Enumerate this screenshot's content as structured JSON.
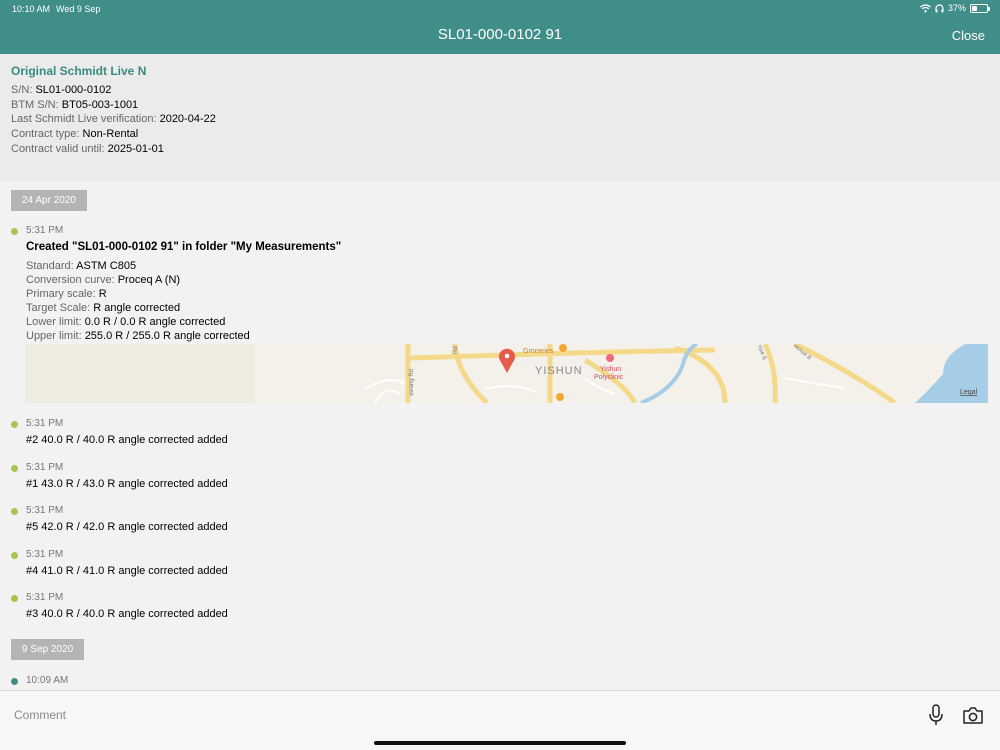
{
  "status_bar": {
    "time": "10:10 AM",
    "date": "Wed 9 Sep",
    "battery": "37%",
    "battery_level": 0.37
  },
  "nav": {
    "title": "SL01-000-0102 91",
    "close_label": "Close"
  },
  "device": {
    "name": "Original Schmidt Live N",
    "fields": [
      {
        "label": "S/N:",
        "value": "SL01-000-0102"
      },
      {
        "label": "BTM S/N:",
        "value": "BT05-003-1001"
      },
      {
        "label": "Last Schmidt Live verification:",
        "value": "2020-04-22"
      },
      {
        "label": "Contract type:",
        "value": "Non-Rental"
      },
      {
        "label": "Contract valid until:",
        "value": "2025-01-01"
      }
    ]
  },
  "timeline": {
    "date1": "24 Apr 2020",
    "created": {
      "time": "5:31 PM",
      "title": "Created \"SL01-000-0102 91\" in folder \"My Measurements\"",
      "details": [
        {
          "label": "Standard:",
          "value": "ASTM C805"
        },
        {
          "label": "Conversion curve:",
          "value": "Proceq A (N)"
        },
        {
          "label": "Primary scale:",
          "value": "R"
        },
        {
          "label": "Target Scale:",
          "value": "R angle corrected"
        },
        {
          "label": "Lower limit:",
          "value": "0.0 R / 0.0 R angle corrected"
        },
        {
          "label": "Upper limit:",
          "value": "255.0 R / 255.0 R angle corrected"
        }
      ]
    },
    "map": {
      "area_label": "YISHUN",
      "poi1": "Groceries",
      "poi2": "Yishun\nPolyclinic",
      "poi2_line1": "Yishun",
      "poi2_line2": "Polyclinic",
      "road1": "awang Rd",
      "road2": "Rd",
      "road3": "nue 6",
      "road4": "venue 8",
      "legal": "Legal"
    },
    "measurements": [
      {
        "time": "5:31 PM",
        "text": "#2 40.0 R / 40.0 R angle corrected added"
      },
      {
        "time": "5:31 PM",
        "text": "#1 43.0 R / 43.0 R angle corrected added"
      },
      {
        "time": "5:31 PM",
        "text": "#5 42.0 R / 42.0 R angle corrected added"
      },
      {
        "time": "5:31 PM",
        "text": "#4 41.0 R / 41.0 R angle corrected added"
      },
      {
        "time": "5:31 PM",
        "text": "#3 40.0 R / 40.0 R angle corrected added"
      }
    ],
    "date2": "9 Sep 2020",
    "last_entry_time": "10:09 AM"
  },
  "footer": {
    "comment_placeholder": "Comment"
  },
  "colors": {
    "header": "#408e88",
    "accent_dot": "#a6c749",
    "teal_dot": "#408e88",
    "device_name": "#3a8a80"
  }
}
